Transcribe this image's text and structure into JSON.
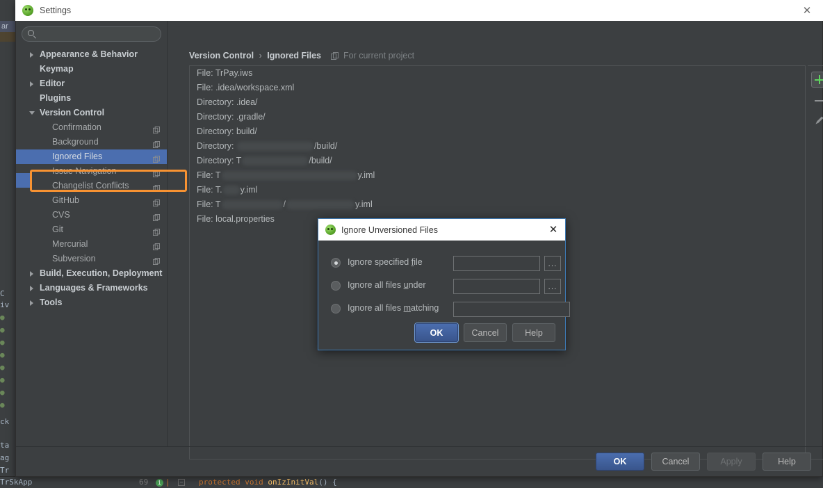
{
  "window": {
    "title": "Settings",
    "close_label": "✕",
    "app_icon": "android-studio-icon"
  },
  "search": {
    "value": "",
    "placeholder": "",
    "icon": "search-icon"
  },
  "sidebar": {
    "items": [
      {
        "label": "Appearance & Behavior",
        "level": "top",
        "arrow": "collapsed",
        "copy": false
      },
      {
        "label": "Keymap",
        "level": "top",
        "arrow": "none",
        "copy": false
      },
      {
        "label": "Editor",
        "level": "top",
        "arrow": "collapsed",
        "copy": false
      },
      {
        "label": "Plugins",
        "level": "top",
        "arrow": "none",
        "copy": false
      },
      {
        "label": "Version Control",
        "level": "top",
        "arrow": "expanded",
        "copy": false
      },
      {
        "label": "Confirmation",
        "level": "child",
        "arrow": "none",
        "copy": true
      },
      {
        "label": "Background",
        "level": "child",
        "arrow": "none",
        "copy": true
      },
      {
        "label": "Ignored Files",
        "level": "child",
        "arrow": "none",
        "copy": true,
        "selected": true
      },
      {
        "label": "Issue Navigation",
        "level": "child",
        "arrow": "none",
        "copy": true
      },
      {
        "label": "Changelist Conflicts",
        "level": "child",
        "arrow": "none",
        "copy": true
      },
      {
        "label": "GitHub",
        "level": "child",
        "arrow": "none",
        "copy": true
      },
      {
        "label": "CVS",
        "level": "child",
        "arrow": "none",
        "copy": true
      },
      {
        "label": "Git",
        "level": "child",
        "arrow": "none",
        "copy": true
      },
      {
        "label": "Mercurial",
        "level": "child",
        "arrow": "none",
        "copy": true
      },
      {
        "label": "Subversion",
        "level": "child",
        "arrow": "none",
        "copy": true
      },
      {
        "label": "Build, Execution, Deployment",
        "level": "top",
        "arrow": "collapsed",
        "copy": false
      },
      {
        "label": "Languages & Frameworks",
        "level": "top",
        "arrow": "collapsed",
        "copy": false
      },
      {
        "label": "Tools",
        "level": "top",
        "arrow": "collapsed",
        "copy": false
      }
    ]
  },
  "breadcrumb": {
    "root": "Version Control",
    "separator": "›",
    "current": "Ignored Files",
    "scope": "For current project",
    "scope_icon": "copy-scope-icon"
  },
  "ignored_list": {
    "rows": [
      {
        "text": "File: TrPay.iws",
        "segments": [
          {
            "t": "File: TrPay.iws"
          }
        ]
      },
      {
        "text": "File: .idea/workspace.xml",
        "segments": [
          {
            "t": "File: .idea/workspace.xml"
          }
        ]
      },
      {
        "text": "Directory: .idea/",
        "segments": [
          {
            "t": "Directory: .idea/"
          }
        ]
      },
      {
        "text": "Directory: .gradle/",
        "segments": [
          {
            "t": "Directory: .gradle/"
          }
        ]
      },
      {
        "text": "Directory: build/",
        "segments": [
          {
            "t": "Directory: build/"
          }
        ]
      },
      {
        "text": "Directory: [redacted]/build/",
        "segments": [
          {
            "t": "Directory: "
          },
          {
            "blur": 110
          },
          {
            "t": "/build/"
          }
        ]
      },
      {
        "text": "Directory: T[redacted]/build/",
        "segments": [
          {
            "t": "Directory: T"
          },
          {
            "blur": 95
          },
          {
            "t": "/build/"
          }
        ]
      },
      {
        "text": "File: T[redacted]y.iml",
        "segments": [
          {
            "t": "File: T"
          },
          {
            "blur": 195
          },
          {
            "t": "y.iml"
          }
        ]
      },
      {
        "text": "File: T.[redacted]y.iml",
        "segments": [
          {
            "t": "File: T."
          },
          {
            "blur": 24
          },
          {
            "t": "y.iml"
          }
        ]
      },
      {
        "text": "File: T[redacted]/[redacted]y.iml",
        "segments": [
          {
            "t": "File: T"
          },
          {
            "blur": 88
          },
          {
            "t": "/"
          },
          {
            "blur": 98
          },
          {
            "t": "y.iml"
          }
        ]
      },
      {
        "text": "File: local.properties",
        "segments": [
          {
            "t": "File: local.properties"
          }
        ]
      }
    ]
  },
  "list_tools": {
    "add": {
      "name": "add-button",
      "glyph": "+"
    },
    "remove": {
      "name": "remove-button",
      "glyph": "−"
    },
    "edit": {
      "name": "edit-pencil-button",
      "glyph": "✎"
    },
    "add_color": "#5fd45f"
  },
  "footer": {
    "ok": "OK",
    "cancel": "Cancel",
    "apply": "Apply",
    "help": "Help",
    "apply_disabled": true
  },
  "dialog": {
    "title": "Ignore Unversioned Files",
    "close_label": "✕",
    "options": [
      {
        "label_pre": "Ignore specified ",
        "label_underline": "f",
        "label_post": "ile",
        "selected": true,
        "has_field": true,
        "has_browse": true,
        "value": "",
        "placeholder": ""
      },
      {
        "label_pre": "Ignore all files ",
        "label_underline": "u",
        "label_post": "nder",
        "selected": false,
        "has_field": true,
        "has_browse": true,
        "value": "",
        "placeholder": ""
      },
      {
        "label_pre": "Ignore all files ",
        "label_underline": "m",
        "label_post": "atching",
        "selected": false,
        "has_field": true,
        "has_browse": false,
        "value": "",
        "placeholder": ""
      }
    ],
    "buttons": {
      "ok": "OK",
      "cancel": "Cancel",
      "help": "Help"
    },
    "accent": "#3d7ab5"
  },
  "background_ide": {
    "edge_labels": [
      "C",
      "iv",
      "ck",
      "ta",
      "ag",
      "Tr"
    ],
    "status": {
      "file": "TrSkApp",
      "line": "69",
      "marker": "1",
      "code_prefix": "protected void ",
      "code_method": "onIzInitVal",
      "code_suffix": "() {"
    }
  },
  "colors": {
    "window_bg": "#3c3f41",
    "selection": "#4b6eaf",
    "highlight": "#f79232",
    "titlebar": "#ffffff"
  }
}
